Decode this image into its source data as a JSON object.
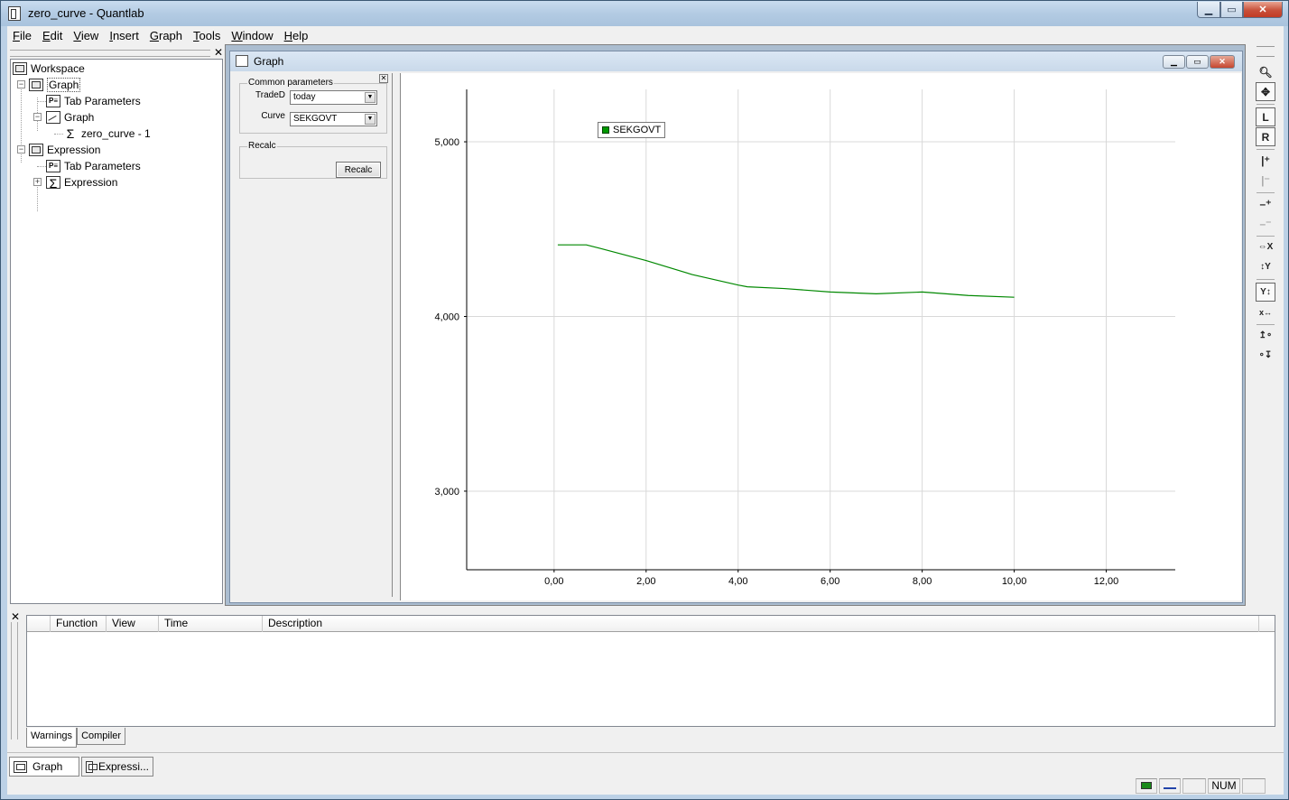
{
  "window": {
    "title": "zero_curve - Quantlab"
  },
  "menu": [
    {
      "pre": "",
      "key": "F",
      "post": "ile"
    },
    {
      "pre": "",
      "key": "E",
      "post": "dit"
    },
    {
      "pre": "",
      "key": "V",
      "post": "iew"
    },
    {
      "pre": "",
      "key": "I",
      "post": "nsert"
    },
    {
      "pre": "",
      "key": "G",
      "post": "raph"
    },
    {
      "pre": "",
      "key": "T",
      "post": "ools"
    },
    {
      "pre": "",
      "key": "W",
      "post": "indow"
    },
    {
      "pre": "",
      "key": "H",
      "post": "elp"
    }
  ],
  "tree": {
    "workspace": "Workspace",
    "graph": "Graph",
    "graph_tab_params": "Tab Parameters",
    "graph_sub": "Graph",
    "zero_curve": "zero_curve - 1",
    "expression": "Expression",
    "expr_tab_params": "Tab Parameters",
    "expr_sub": "Expression"
  },
  "graph_window": {
    "title": "Graph",
    "common_params_title": "Common parameters",
    "traded_label": "TradeD",
    "traded_value": "today",
    "curve_label": "Curve",
    "curve_value": "SEKGOVT",
    "recalc_group": "Recalc",
    "recalc_button": "Recalc"
  },
  "chart_data": {
    "type": "line",
    "series": [
      {
        "name": "SEKGOVT",
        "color": "#008800",
        "x": [
          0.08,
          0.5,
          0.7,
          1.0,
          2.0,
          3.0,
          4.0,
          4.2,
          5.0,
          6.0,
          7.0,
          8.0,
          9.0,
          10.0
        ],
        "y": [
          4.41,
          4.41,
          4.41,
          4.39,
          4.32,
          4.24,
          4.18,
          4.17,
          4.16,
          4.14,
          4.13,
          4.14,
          4.12,
          4.11
        ]
      }
    ],
    "xlim": [
      -1.9,
      13.5
    ],
    "ylim": [
      2.55,
      5.3
    ],
    "x_ticks": [
      0,
      2,
      4,
      6,
      8,
      10,
      12
    ],
    "x_tick_labels": [
      "0,00",
      "2,00",
      "4,00",
      "6,00",
      "8,00",
      "10,00",
      "12,00"
    ],
    "y_ticks": [
      3,
      4,
      5
    ],
    "y_tick_labels": [
      "3,000",
      "4,000",
      "5,000"
    ],
    "grid": true,
    "legend": "top-left"
  },
  "output": {
    "columns": [
      "",
      "Function",
      "View",
      "Time",
      "Description"
    ],
    "tabs": [
      "Warnings",
      "Compiler"
    ]
  },
  "window_tabs": [
    "Graph",
    "Expressi..."
  ],
  "status": {
    "num": "NUM"
  }
}
